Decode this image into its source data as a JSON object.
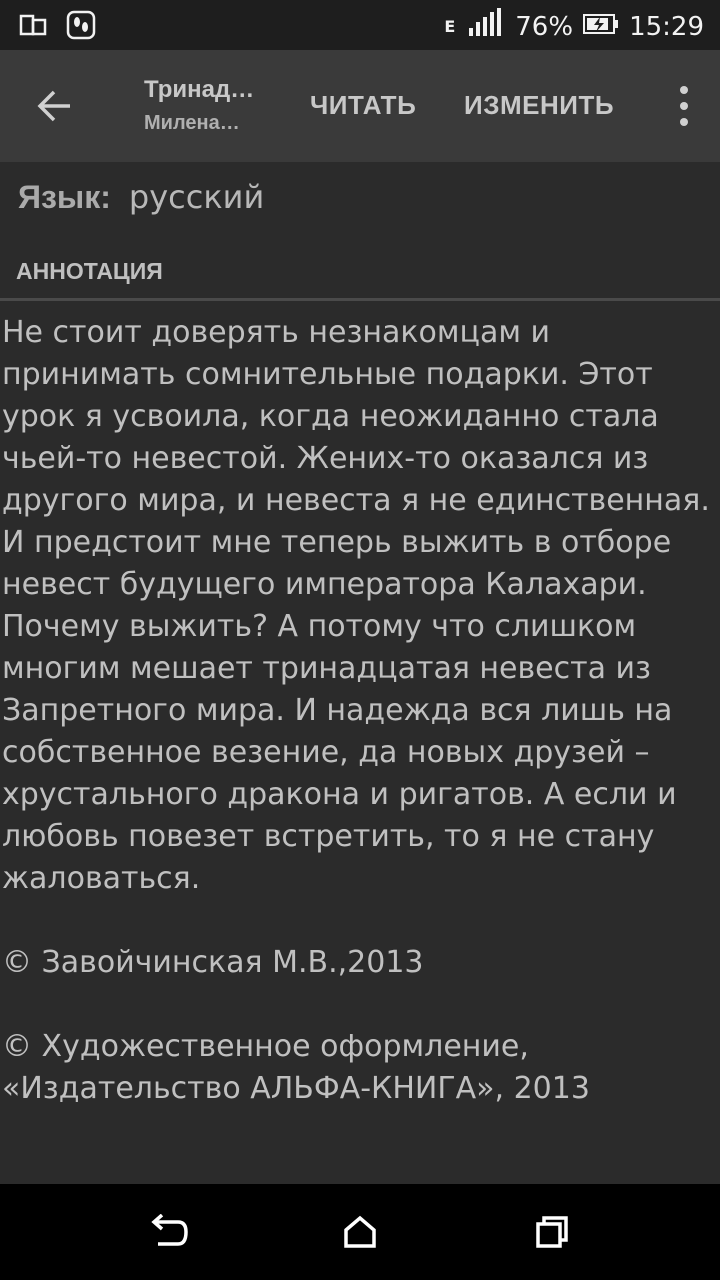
{
  "status_bar": {
    "network_type": "E",
    "battery": "76%",
    "time": "15:29"
  },
  "toolbar": {
    "title": "Тринад…",
    "subtitle": "Милена…",
    "read_label": "ЧИТАТЬ",
    "edit_label": "ИЗМЕНИТЬ"
  },
  "language": {
    "label": "Язык:",
    "value": "русский"
  },
  "annotation": {
    "heading": "АННОТАЦИЯ",
    "text": "Не стоит доверять незнакомцам и принимать сомнительные подарки. Этот урок я усвоила, когда неожиданно стала чьей-то невестой. Жених-то оказался из другого мира, и невеста я не единственная. И предстоит мне теперь выжить в отборе невест будущего императора Калахари. Почему выжить? А потому что слишком многим мешает тринадцатая невеста из Запретного мира. И надежда вся лишь на собственное везение, да новых друзей – хрустального дракона и ригатов. А если и любовь повезет встретить, то я не стану жаловаться.",
    "copyright1": "© Завойчинская М.В.,2013",
    "copyright2": "© Художественное оформление, «Издательство АЛЬФА-КНИГА», 2013"
  }
}
